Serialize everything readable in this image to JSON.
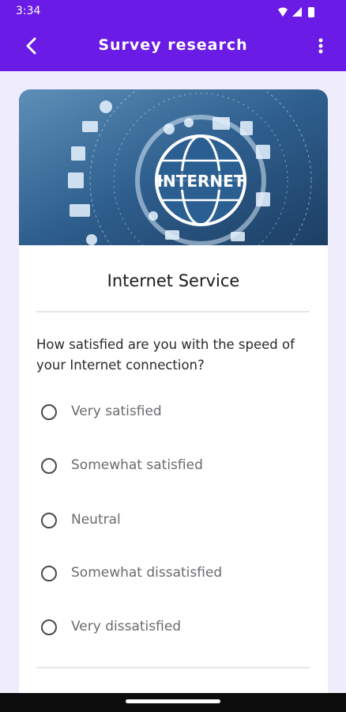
{
  "status_bar": {
    "time": "3:34",
    "icons": [
      "wifi-icon",
      "signal-icon",
      "battery-icon"
    ]
  },
  "app_bar": {
    "title": "Survey research",
    "back_icon": "back-arrow-icon",
    "menu_icon": "more-vert-icon"
  },
  "banner": {
    "text": "INTERNET"
  },
  "survey": {
    "heading": "Internet Service",
    "question": "How satisfied are you with the speed of your Internet connection?",
    "options": [
      {
        "label": "Very satisfied",
        "selected": false
      },
      {
        "label": "Somewhat satisfied",
        "selected": false
      },
      {
        "label": "Neutral",
        "selected": false
      },
      {
        "label": "Somewhat dissatisfied",
        "selected": false
      },
      {
        "label": "Very dissatisfied",
        "selected": false
      }
    ]
  },
  "colors": {
    "accent": "#6a1be6",
    "background": "#efecfb",
    "card": "#ffffff"
  }
}
